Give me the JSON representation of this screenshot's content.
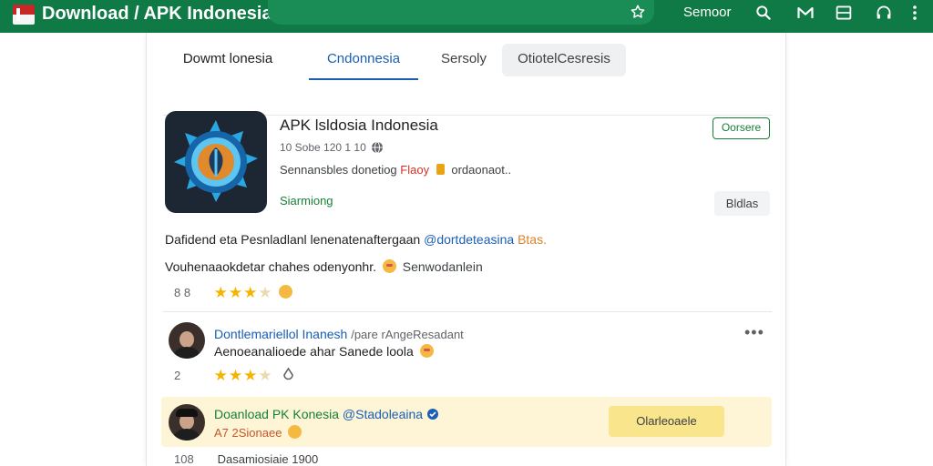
{
  "header": {
    "title": "Download / APK Indonesia",
    "search_label": "Semoor",
    "icons": [
      "flag-icon",
      "star-icon",
      "search-icon",
      "mail-icon",
      "window-icon",
      "headset-icon",
      "more-vert-icon"
    ]
  },
  "tabs": [
    {
      "label": "Dowmt lonesia"
    },
    {
      "label": "Cndonnesia",
      "active": true
    },
    {
      "label": "Sersoly"
    },
    {
      "label": "OtiotelCesresis"
    }
  ],
  "app": {
    "name": "APK lsldosia Indonesia",
    "meta": "10 Sobe 120 1 10",
    "desc_prefix": "Sennansbles donetiog",
    "desc_red": "Flaoy",
    "desc_suffix": "ordaonaot..",
    "status": "Siarmiong",
    "open_label": "Oorsere",
    "details_label": "Bldlas"
  },
  "description": {
    "line1_text": "Dafidend eta Pesnladlanl lenenatenaftergaan",
    "line1_link": "@dortdeteasina",
    "line1_orange": "Btas.",
    "line2_text": "Vouhenaaokdetar chahes odenyonhr.",
    "line2_muted": "Senwodanlein",
    "rating_count": "8 8",
    "rating_stars": 3
  },
  "review1": {
    "name": "Dontlemariellol Inanesh",
    "name_sub": "/pare rAngeResadant",
    "text": "Aenoeanalioede ahar Sanede loola",
    "count": "2",
    "stars": 3
  },
  "review2": {
    "name": "Doanload PK Konesia",
    "name_link": "@Stadoleaina",
    "sub": "A7 2Sionaee",
    "button_label": "Olarleoaele"
  },
  "footer": {
    "count": "108",
    "text": "Dasamiosiaie 1900"
  },
  "colors": {
    "brand_green": "#0f7a46",
    "accent_blue": "#1a5fb4",
    "status_green": "#188038",
    "star": "#f5b400",
    "highlight_bg": "#fdf5d6"
  }
}
